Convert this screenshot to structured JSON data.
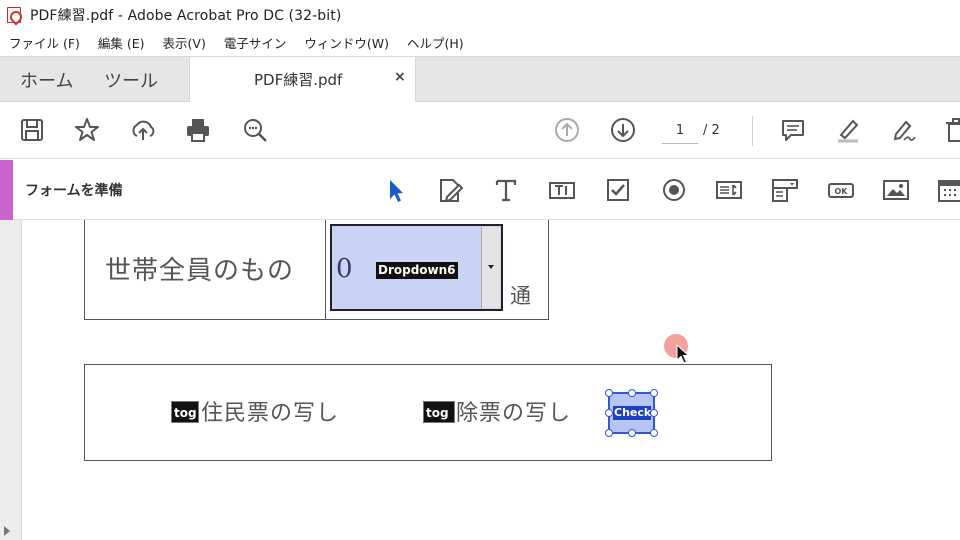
{
  "window": {
    "title": "PDF練習.pdf - Adobe Acrobat Pro DC (32-bit)"
  },
  "menubar": {
    "items": [
      "ファイル (F)",
      "編集 (E)",
      "表示(V)",
      "電子サイン",
      "ウィンドウ(W)",
      "ヘルプ(H)"
    ]
  },
  "tabs": {
    "home": "ホーム",
    "tools": "ツール",
    "document": "PDF練習.pdf",
    "close": "×"
  },
  "toolbar": {
    "icons": [
      "save-icon",
      "bookmark-star-icon",
      "cloud-upload-icon",
      "print-icon",
      "zoom-search-icon",
      "page-up-icon",
      "page-down-icon",
      "comment-icon",
      "highlight-pen-icon",
      "sign-icon",
      "delete-icon"
    ],
    "current_page": "1",
    "page_total": "/ 2"
  },
  "formbar": {
    "title": "フォームを準備",
    "accent_color": "#c964cf",
    "tools": [
      "select-pointer-icon",
      "edit-form-icon",
      "text-tool-icon",
      "text-field-icon",
      "checkbox-tool-icon",
      "radio-button-icon",
      "list-box-icon",
      "dropdown-tool-icon",
      "button-ok-icon",
      "image-field-icon",
      "date-field-icon"
    ]
  },
  "document": {
    "row1_label": "世帯全員のもの",
    "dropdown_value": "0",
    "dropdown_name": "Dropdown6",
    "unit_label": "通",
    "toggle1_name": "tog",
    "item1_label": "住民票の写し",
    "toggle2_name": "tog",
    "item2_label": "除票の写し",
    "checkbox_name": "Check"
  },
  "colors": {
    "field_fill": "#c9d3f5",
    "selected_field": "#3457d5",
    "pointer_blue": "#1a5dc8"
  }
}
